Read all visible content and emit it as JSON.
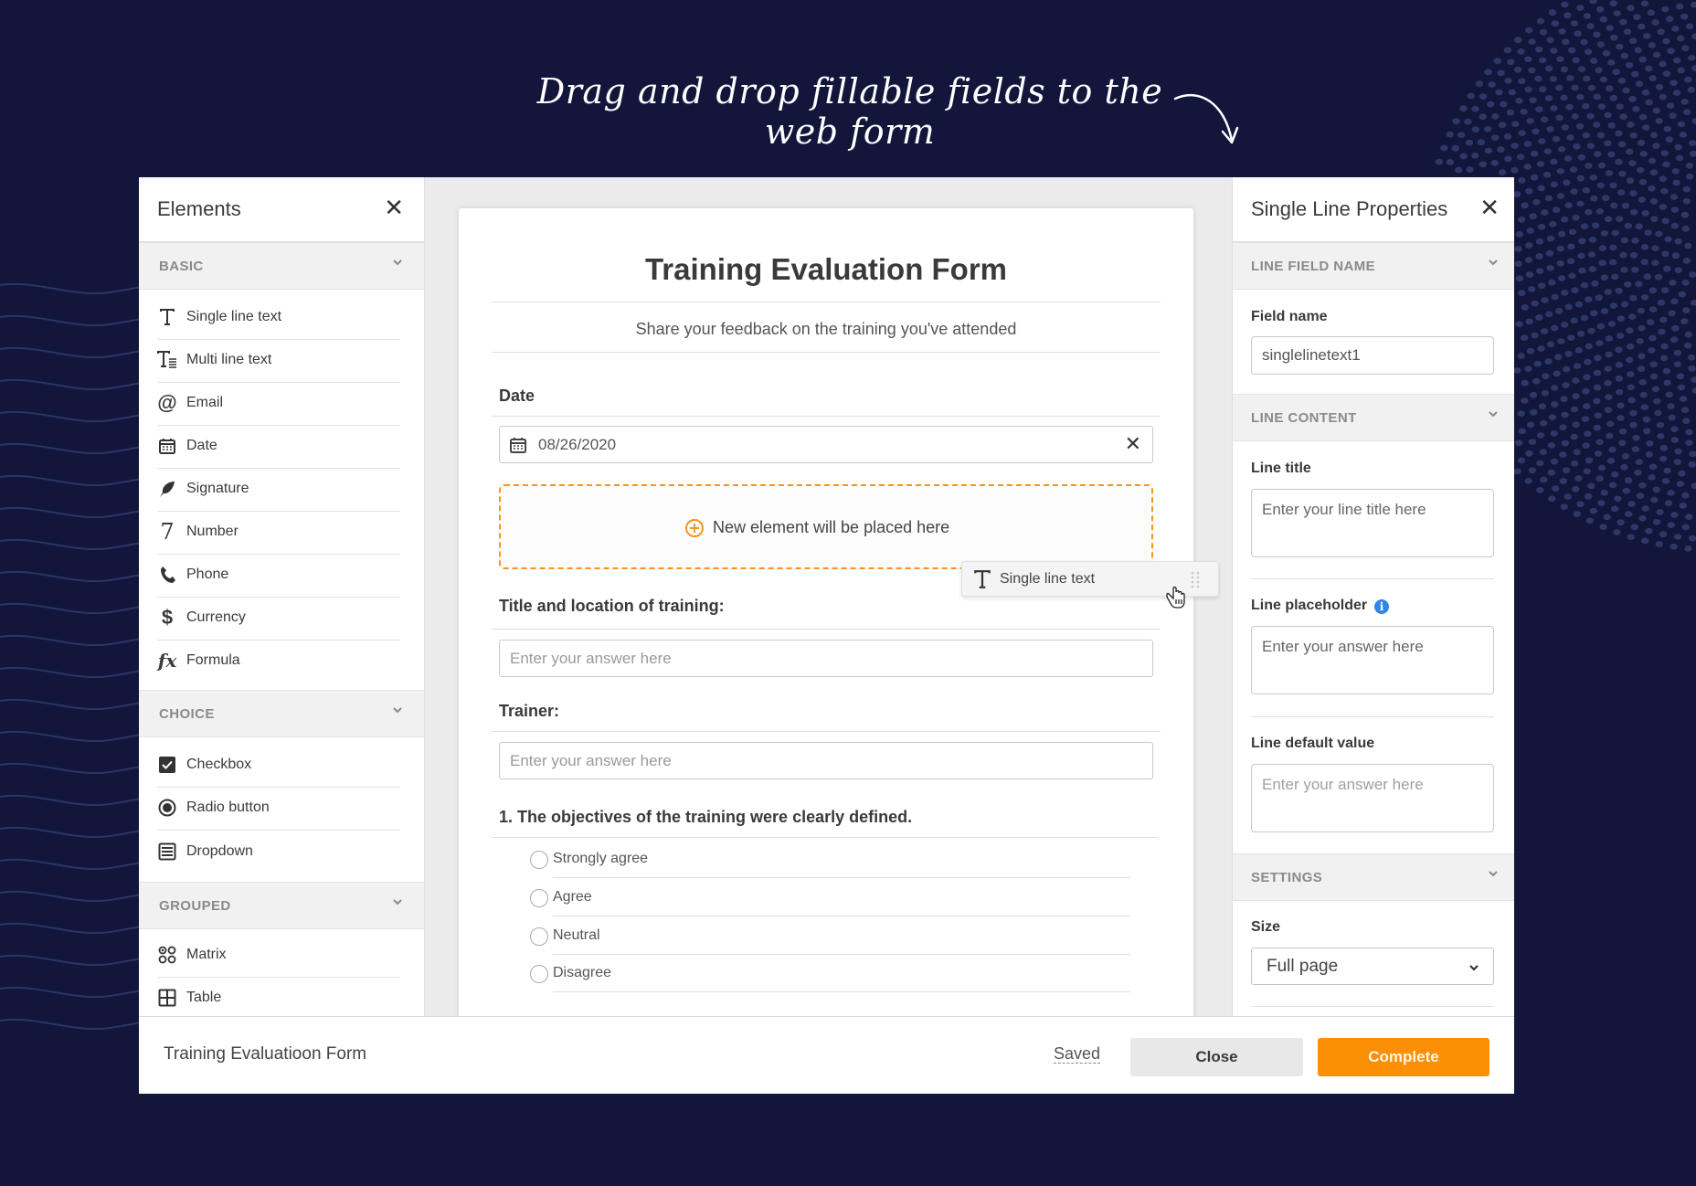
{
  "headline": "Drag and drop fillable fields to the web form",
  "colors": {
    "background": "#11163a",
    "accent_orange": "#f7941d",
    "complete_button": "#fb8f06",
    "info_blue": "#2f86e6"
  },
  "elements_panel": {
    "title": "Elements",
    "close_icon": "close-icon",
    "sections": [
      {
        "label": "BASIC",
        "items": [
          {
            "label": "Single line text",
            "icon": "text-t-icon"
          },
          {
            "label": "Multi line text",
            "icon": "multiline-text-icon"
          },
          {
            "label": "Email",
            "icon": "at-sign-icon"
          },
          {
            "label": "Date",
            "icon": "calendar-icon"
          },
          {
            "label": "Signature",
            "icon": "feather-icon"
          },
          {
            "label": "Number",
            "icon": "number-seven-icon"
          },
          {
            "label": "Phone",
            "icon": "phone-icon"
          },
          {
            "label": "Currency",
            "icon": "dollar-icon"
          },
          {
            "label": "Formula",
            "icon": "function-fx-icon"
          }
        ]
      },
      {
        "label": "CHOICE",
        "items": [
          {
            "label": "Checkbox",
            "icon": "checkbox-icon"
          },
          {
            "label": "Radio button",
            "icon": "radio-icon"
          },
          {
            "label": "Dropdown",
            "icon": "dropdown-list-icon"
          }
        ]
      },
      {
        "label": "GROUPED",
        "items": [
          {
            "label": "Matrix",
            "icon": "matrix-icon"
          },
          {
            "label": "Table",
            "icon": "table-icon"
          }
        ]
      }
    ]
  },
  "form": {
    "title": "Training Evaluation Form",
    "subtitle": "Share your feedback on the training you've attended",
    "date": {
      "label": "Date",
      "value": "08/26/2020"
    },
    "drop_zone": "New element will be placed here",
    "title_location": {
      "label": "Title and location of training:",
      "placeholder": "Enter your answer here"
    },
    "trainer": {
      "label": "Trainer:",
      "placeholder": "Enter your answer here"
    },
    "question1": {
      "label": "1. The objectives of the training were clearly defined.",
      "options": [
        "Strongly agree",
        "Agree",
        "Neutral",
        "Disagree"
      ]
    }
  },
  "drag_ghost": {
    "label": "Single line text",
    "icon": "text-t-icon"
  },
  "properties_panel": {
    "title": "Single Line Properties",
    "sections": {
      "field_name": "LINE FIELD NAME",
      "content": "LINE CONTENT",
      "settings": "SETTINGS"
    },
    "field_name": {
      "label": "Field name",
      "value": "singlelinetext1"
    },
    "line_title": {
      "label": "Line title",
      "placeholder": "Enter your line title here"
    },
    "line_placeholder": {
      "label": "Line placeholder",
      "value": "Enter your answer here"
    },
    "line_default": {
      "label": "Line default value",
      "placeholder": "Enter your answer here"
    },
    "size": {
      "label": "Size",
      "value": "Full page"
    }
  },
  "footer": {
    "form_name": "Training Evaluatioon Form",
    "status": "Saved",
    "close_label": "Close",
    "complete_label": "Complete"
  }
}
